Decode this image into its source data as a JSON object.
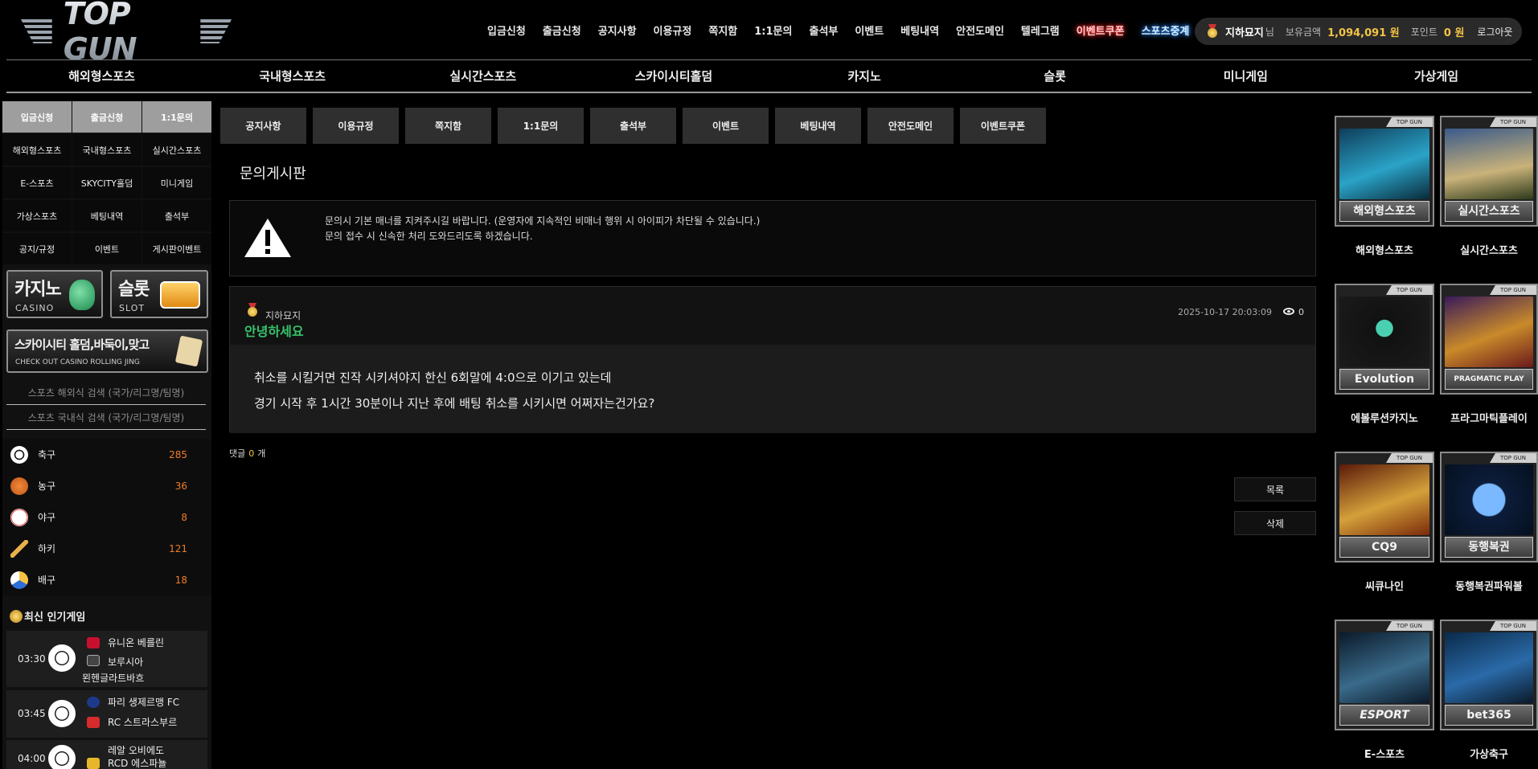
{
  "logo": {
    "text": "TOP GUN"
  },
  "topnav": [
    "입금신청",
    "출금신청",
    "공지사항",
    "이용규정",
    "쪽지함",
    "1:1문의",
    "출석부",
    "이벤트",
    "베팅내역",
    "안전도메인",
    "텔레그램",
    "이벤트쿠폰",
    "스포츠중계"
  ],
  "user": {
    "nickname": "지하묘지",
    "suffix": "님",
    "balance_label": "보유금액",
    "balance": "1,094,091 원",
    "points_label": "포인트",
    "points": "0 원",
    "logout": "로그아웃"
  },
  "categories": [
    "해외형스포츠",
    "국내형스포츠",
    "실시간스포츠",
    "스카이시티홀덤",
    "카지노",
    "슬롯",
    "미니게임",
    "가상게임"
  ],
  "sidebar": {
    "grid": [
      "입금신청",
      "출금신청",
      "1:1문의",
      "해외형스포츠",
      "국내형스포츠",
      "실시간스포츠",
      "E-스포츠",
      "SKYCITY홀덤",
      "미니게임",
      "가상스포츠",
      "베팅내역",
      "출석부",
      "공지/규정",
      "이벤트",
      "게시판이벤트"
    ],
    "banners": {
      "casino_big": "카지노",
      "casino_small": "CASINO",
      "slot_big": "슬롯",
      "slot_small": "SLOT",
      "sky_big": "스카이시티 홀덤,바둑이,맞고",
      "sky_small": "CHECK OUT CASINO ROLLING JING"
    },
    "search_overseas": "스포츠 해외식 검색 (국가/리그명/팀명)",
    "search_domestic": "스포츠 국내식 검색 (국가/리그명/팀명)",
    "sports": [
      {
        "name": "축구",
        "count": "285",
        "icon": "soccer-icon"
      },
      {
        "name": "농구",
        "count": "36",
        "icon": "basketball-icon"
      },
      {
        "name": "야구",
        "count": "8",
        "icon": "baseball-icon"
      },
      {
        "name": "하키",
        "count": "121",
        "icon": "hockey-icon"
      },
      {
        "name": "배구",
        "count": "18",
        "icon": "volleyball-icon"
      }
    ],
    "popular_title": "최신 인기게임",
    "games": [
      {
        "time": "03:30",
        "home": "유니온 베를린",
        "away": "보루시아",
        "away2": "묀헨글라트바흐"
      },
      {
        "time": "03:45",
        "home": "파리 생제르맹 FC",
        "away": "RC 스트라스부르"
      },
      {
        "time": "04:00",
        "home": "레알 오비에도",
        "away": "RCD 에스파뇰"
      }
    ]
  },
  "tabs": [
    "공지사항",
    "이용규정",
    "쪽지함",
    "1:1문의",
    "출석부",
    "이벤트",
    "베팅내역",
    "안전도메인",
    "이벤트쿠폰"
  ],
  "board_title": "문의게시판",
  "notice": {
    "line1": "문의시 기본 매너를 지켜주시길 바랍니다. (운영자에 지속적인 비매너 행위 시 아이피가 차단될 수 있습니다.)",
    "line2": "문의 접수 시 신속한 처리 도와드리도록 하겠습니다."
  },
  "post": {
    "author": "지하묘지",
    "subject": "안녕하세요",
    "date": "2025-10-17 20:03:09",
    "views": "0",
    "body_line1": "취소를 시킬거면 진작 시키셔야지 한신 6회말에 4:0으로 이기고 있는데",
    "body_line2": "경기 시작 후 1시간 30분이나 지난 후에 배팅 취소를 시키시면 어쩌자는건가요?"
  },
  "comments": {
    "label": "댓글",
    "count": "0",
    "unit": "개"
  },
  "buttons": {
    "list": "목록",
    "delete": "삭제"
  },
  "tiles": [
    {
      "caption": "해외형스포츠",
      "label": "해외형스포츠"
    },
    {
      "caption": "실시간스포츠",
      "label": "실시간스포츠"
    },
    {
      "caption": "Evolution",
      "label": "에볼루션카지노"
    },
    {
      "caption": "PRAGMATIC PLAY",
      "label": "프라그마틱플레이"
    },
    {
      "caption": "CQ9",
      "label": "씨큐나인"
    },
    {
      "caption": "동행복권",
      "label": "동행복권파워볼"
    },
    {
      "caption": "ESPORT",
      "label": "E-스포츠"
    },
    {
      "caption": "bet365",
      "label": "가상축구"
    }
  ],
  "tile_tag": "TOP GUN",
  "colors": {
    "accent_gold": "#f3c445",
    "count_orange": "#f07d2a",
    "subject_green": "#36c36a",
    "coupon_glow": "#ff2a2a",
    "live_glow": "#2a8aff"
  }
}
